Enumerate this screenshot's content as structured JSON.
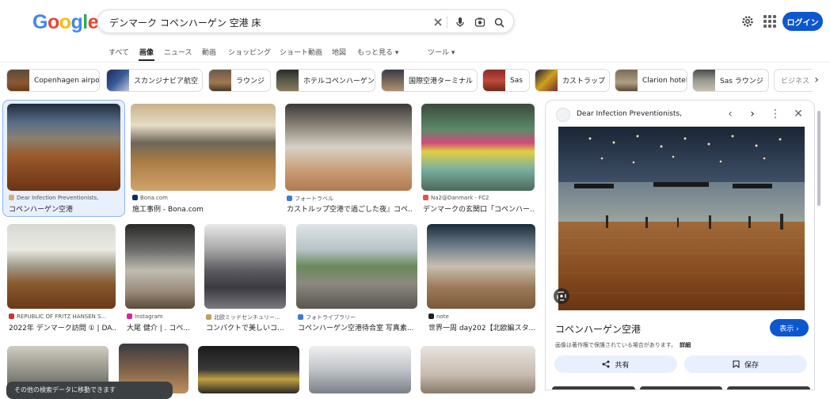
{
  "header": {
    "logo": "Google",
    "search_query": "デンマーク コペンハーゲン 空港 床",
    "login_label": "ログイン"
  },
  "tabs": [
    {
      "label": "すべて"
    },
    {
      "label": "画像"
    },
    {
      "label": "ニュース"
    },
    {
      "label": "動画"
    },
    {
      "label": "ショッピング"
    },
    {
      "label": "ショート動画"
    },
    {
      "label": "地図"
    },
    {
      "label": "もっと見る ▾"
    },
    {
      "label": "ツール ▾"
    }
  ],
  "chips": [
    {
      "label": "Copenhagen airport"
    },
    {
      "label": "スカンジナビア航空"
    },
    {
      "label": "ラウンジ"
    },
    {
      "label": "ホテルコペンハーゲン"
    },
    {
      "label": "国際空港ターミナル"
    },
    {
      "label": "Sas"
    },
    {
      "label": "カストラップ"
    },
    {
      "label": "Clarion hotel"
    },
    {
      "label": "Sas ラウンジ"
    },
    {
      "label": "ビジネス"
    }
  ],
  "results_row1": [
    {
      "source": "Dear Infection Preventionists,",
      "caption": "コペンハーゲン空港"
    },
    {
      "source": "Bona.com",
      "caption": "施工事例 - Bona.com"
    },
    {
      "source": "フォートラベル",
      "caption": "カストルップ空港で過ごした夜』コペ..."
    },
    {
      "source": "Na2@Danmark - FC2",
      "caption": "デンマークの玄関口「コペンハー..."
    }
  ],
  "results_row2": [
    {
      "source": "REPUBLIC OF FRITZ HANSEN S...",
      "caption": "2022年 デンマーク訪問 ① | DA..."
    },
    {
      "source": "Instagram",
      "caption": "大尾 健介 | . コペ..."
    },
    {
      "source": "北欧ミッドセンチュリー...",
      "caption": "コンパクトで美しいコ..."
    },
    {
      "source": "フォトライブラリー",
      "caption": "コペンハーゲン空港待合室 写真素..."
    },
    {
      "source": "note",
      "caption": "世界一周 day202【北欧編スタ..."
    }
  ],
  "panel": {
    "source": "Dear Infection Preventionists,",
    "title": "コペンハーゲン空港",
    "view_label": "表示 ›",
    "copyright": "画像は著作権で保護されている場合があります。",
    "details": "詳細",
    "share_label": "共有",
    "save_label": "保存"
  },
  "toast": "その他の検索データに移動できます",
  "colors": {
    "accent": "#0b57d0",
    "chip_border": "#dadce0"
  }
}
